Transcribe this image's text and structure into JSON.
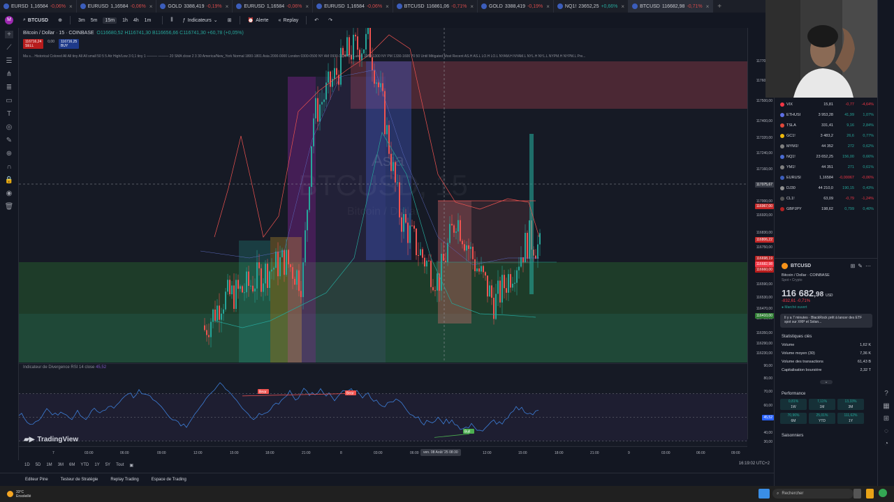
{
  "tabs": [
    {
      "symbol": "EURSD",
      "price": "1,16584",
      "change": "-0,06%",
      "dir": "dn"
    },
    {
      "symbol": "EURUSD",
      "price": "1,16584",
      "change": "-0,06%",
      "dir": "dn"
    },
    {
      "symbol": "GOLD",
      "price": "3388,419",
      "change": "-0,19%",
      "dir": "dn"
    },
    {
      "symbol": "EURUSD",
      "price": "1,16584",
      "change": "-0,06%",
      "dir": "dn"
    },
    {
      "symbol": "EURUSD",
      "price": "1,16584",
      "change": "-0,06%",
      "dir": "dn"
    },
    {
      "symbol": "BTCUSD",
      "price": "116861,06",
      "change": "-0,71%",
      "dir": "dn"
    },
    {
      "symbol": "GOLD",
      "price": "3388,419",
      "change": "-0,19%",
      "dir": "dn"
    },
    {
      "symbol": "NQ1!",
      "price": "23652,25",
      "change": "+0,66%",
      "dir": "up"
    },
    {
      "symbol": "BTCUSD",
      "price": "116682,98",
      "change": "-0,71%",
      "dir": "dn",
      "active": true
    }
  ],
  "toolbar": {
    "symbol": "BTCUSD",
    "timeframes": [
      "3m",
      "5m",
      "15m",
      "1h",
      "4h",
      "1m"
    ],
    "active_tf": "15m",
    "indicators": "Indicateurs",
    "alert": "Alerte",
    "replay": "Replay"
  },
  "legend": {
    "title": "Bitcoin / Dollar · 15 · COINBASE",
    "ohlc": "O116680,52 H116741,30 B116656,66 C116741,30 +60,78 (+0,05%)",
    "sell": "116716,24",
    "sell_label": "SELL",
    "spread": "0,00",
    "buy": "116716,25",
    "buy_label": "BUY",
    "indicators": "Ma s... Historical Colored All All tiny All All small 50 5 5 Atr High/Low 3 0,1 tiny 1 ——— ——— 20 SMA close 2 3 30 America/New_York Normal 1800-1801 Asia 2000-0000 London 0300-0500 NY AM 0930-1100 NY Lunch 1200-1300 NY PM 1330-1600 70 50 Until Mitigated Most Recent AS.H AS.L LO.H LO.L NYAM.H NYAM.L NYL.H NYL.L NYPM.H NYPM.L Pre..."
  },
  "watermark": {
    "line1": "BTCUSD, 15",
    "line2": "Bitcoin / Dollar",
    "session": "Asia"
  },
  "price_axis": {
    "labels": [
      "117700,00",
      "117600,00",
      "117500,00",
      "117400,00",
      "117320,00",
      "117240,00",
      "117160,00",
      "117000,00",
      "116920,00",
      "116830,00",
      "116750,00",
      "116590,00",
      "116530,00",
      "116470,00",
      "116410,00",
      "116350,00",
      "116290,00",
      "116230,00",
      "90,00",
      "80,00",
      "70,00",
      "60,00",
      "50,00",
      "40,00",
      "30,00"
    ],
    "cursor_tag": "117075,67",
    "red_tag": "116967,00",
    "red_tag2": "116806,22",
    "price_tags": [
      "116698,19",
      "116682,98",
      "116660,00"
    ],
    "green_tag": "116410,00",
    "rsi_tag": "45,52"
  },
  "rsi": {
    "title": "Indicateur de Divergence RSI 14 close",
    "value": "45,52",
    "bear1": "Bear",
    "bear2": "Bear",
    "bull": "Bull"
  },
  "time_axis": {
    "labels": [
      "7",
      "03:00",
      "06:00",
      "09:00",
      "12:00",
      "15:00",
      "18:00",
      "21:00",
      "8",
      "03:00",
      "06:00",
      "12:00",
      "15:00",
      "18:00",
      "21:00",
      "9",
      "03:00",
      "06:00",
      "09:00"
    ],
    "cursor": "ven. 08 Août '25   08:30"
  },
  "ranges": [
    "1D",
    "5D",
    "1M",
    "3M",
    "6M",
    "YTD",
    "1Y",
    "5Y",
    "Tout"
  ],
  "clock": "16:19:02 UTC+2",
  "bottom_tabs": [
    "Editeur Pine",
    "Testeur de Stratégie",
    "Replay Trading",
    "Espace de Trading"
  ],
  "brand": "TradingView",
  "watchlist": [
    {
      "sym": "VIX",
      "last": "15,81",
      "chg": "-0,77",
      "pct": "-4,64%",
      "dir": "dn",
      "color": "#f23645"
    },
    {
      "sym": "ETHUSI",
      "last": "3 953,28",
      "chg": "41,99",
      "pct": "1,07%",
      "dir": "up",
      "color": "#5d6fe6"
    },
    {
      "sym": "TSLA",
      "last": "331,41",
      "chg": "9,16",
      "pct": "2,84%",
      "dir": "up",
      "color": "#e0483a"
    },
    {
      "sym": "GC1!",
      "last": "3 483,2",
      "chg": "26,6",
      "pct": "0,77%",
      "dir": "up",
      "color": "#f0b90b"
    },
    {
      "sym": "MYM1!",
      "last": "44 352",
      "chg": "272",
      "pct": "0,62%",
      "dir": "up",
      "color": "#808080"
    },
    {
      "sym": "NQ1!",
      "last": "23 652,25",
      "chg": "156,00",
      "pct": "0,66%",
      "dir": "up",
      "color": "#4a6cd4"
    },
    {
      "sym": "YM1!",
      "last": "44 351",
      "chg": "271",
      "pct": "0,61%",
      "dir": "up",
      "color": "#808080"
    },
    {
      "sym": "EURUSI",
      "last": "1,16584",
      "chg": "-0,00067",
      "pct": "-0,06%",
      "dir": "dn",
      "color": "#3b5dbb"
    },
    {
      "sym": "DJ30",
      "last": "44 210,0",
      "chg": "190,15",
      "pct": "0,43%",
      "dir": "up",
      "color": "#909090"
    },
    {
      "sym": "CL1!",
      "last": "63,09",
      "chg": "-0,79",
      "pct": "-1,24%",
      "dir": "dn",
      "color": "#555555"
    },
    {
      "sym": "GBPJPY",
      "last": "198,62",
      "chg": "0,799",
      "pct": "0,40%",
      "dir": "up",
      "color": "#b22222"
    }
  ],
  "details": {
    "symbol": "BTCUSD",
    "name": "Bitcoin / Dollar",
    "exchange": "COINBASE",
    "type": "Spot • Crypto",
    "price_main": "116 682",
    "price_dec": ",98",
    "currency": "USD",
    "change": "-832,61  -0,71%",
    "market": "Marché ouvert",
    "news": "Il y a 7 minutes · BlackRock prêt à lancer des ETF spot sur XRP et Solan...",
    "stats_title": "Statistiques clés",
    "stats": [
      {
        "k": "Volume",
        "v": "1,62 K"
      },
      {
        "k": "Volume moyen (30)",
        "v": "7,36 K"
      },
      {
        "k": "Volume des transactions",
        "v": "61,43 B"
      },
      {
        "k": "Capitalisation boursière",
        "v": "2,32 T"
      }
    ],
    "perf_title": "Performance",
    "perf": [
      {
        "v": "0,81%",
        "p": "1W",
        "dir": "up"
      },
      {
        "v": "7,11%",
        "p": "1M",
        "dir": "up"
      },
      {
        "v": "13,33%",
        "p": "3M",
        "dir": "up"
      },
      {
        "v": "70,96%",
        "p": "6M",
        "dir": "up"
      },
      {
        "v": "25,01%",
        "p": "YTD",
        "dir": "up"
      },
      {
        "v": "111,62%",
        "p": "1Y",
        "dir": "up"
      }
    ],
    "season_title": "Saisonniers"
  },
  "taskbar": {
    "weather": "33°C",
    "weather_sub": "Ensoleillé",
    "search": "Rechercher"
  },
  "colors": {
    "bull": "#26a69a",
    "bear": "#ef5350",
    "bg": "#131722",
    "accent": "#2962ff"
  }
}
